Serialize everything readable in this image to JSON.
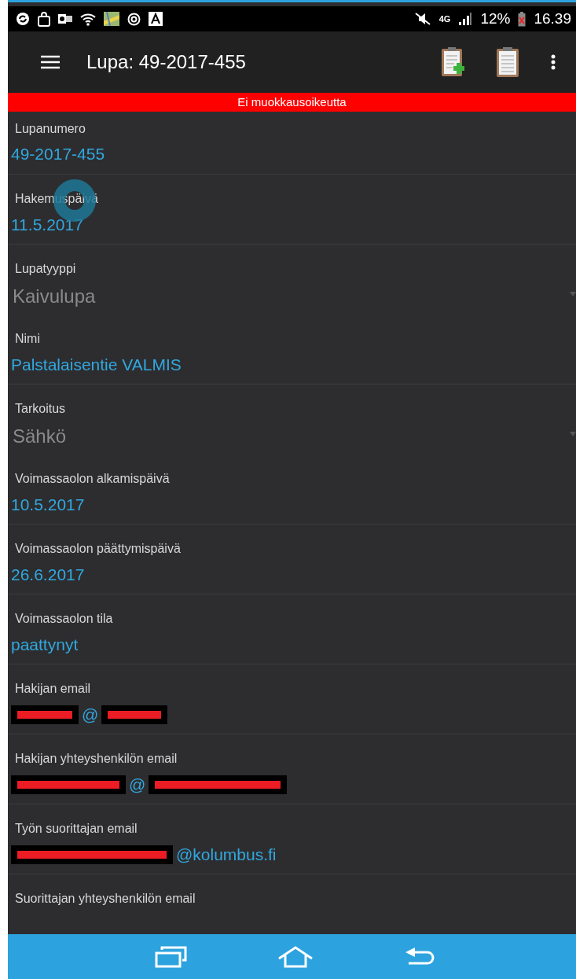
{
  "status_bar": {
    "network": "4G",
    "battery": "12%",
    "time": "16.39"
  },
  "app_bar": {
    "title": "Lupa: 49-2017-455"
  },
  "banner": {
    "text": "Ei muokkausoikeutta"
  },
  "fields": [
    {
      "label": "Lupanumero",
      "kind": "text",
      "value": "49-2017-455"
    },
    {
      "label": "Hakemuspäivä",
      "kind": "text",
      "value": "11.5.2017",
      "touched": true
    },
    {
      "label": "Lupatyyppi",
      "kind": "dropdown",
      "value": "Kaivulupa"
    },
    {
      "label": "Nimi",
      "kind": "text",
      "value": "Palstalaisentie VALMIS"
    },
    {
      "label": "Tarkoitus",
      "kind": "dropdown",
      "value": "Sähkö"
    },
    {
      "label": "Voimassaolon alkamispäivä",
      "kind": "text",
      "value": "10.5.2017"
    },
    {
      "label": "Voimassaolon päättymispäivä",
      "kind": "text",
      "value": "26.6.2017"
    },
    {
      "label": "Voimassaolon tila",
      "kind": "text",
      "value": "paattynyt"
    },
    {
      "label": "Hakijan email",
      "kind": "redacted",
      "value": "@",
      "redacted_before": true,
      "redacted_after": true
    },
    {
      "label": "Hakijan yhteyshenkilön email",
      "kind": "redacted",
      "value": "@",
      "redacted_before": true,
      "redacted_after": true
    },
    {
      "label": "Työn suorittajan email",
      "kind": "redacted",
      "value": "@kolumbus.fi",
      "redacted_before": true,
      "redacted_after": false
    },
    {
      "label": "Suorittajan yhteyshenkilön email",
      "kind": "empty"
    }
  ]
}
